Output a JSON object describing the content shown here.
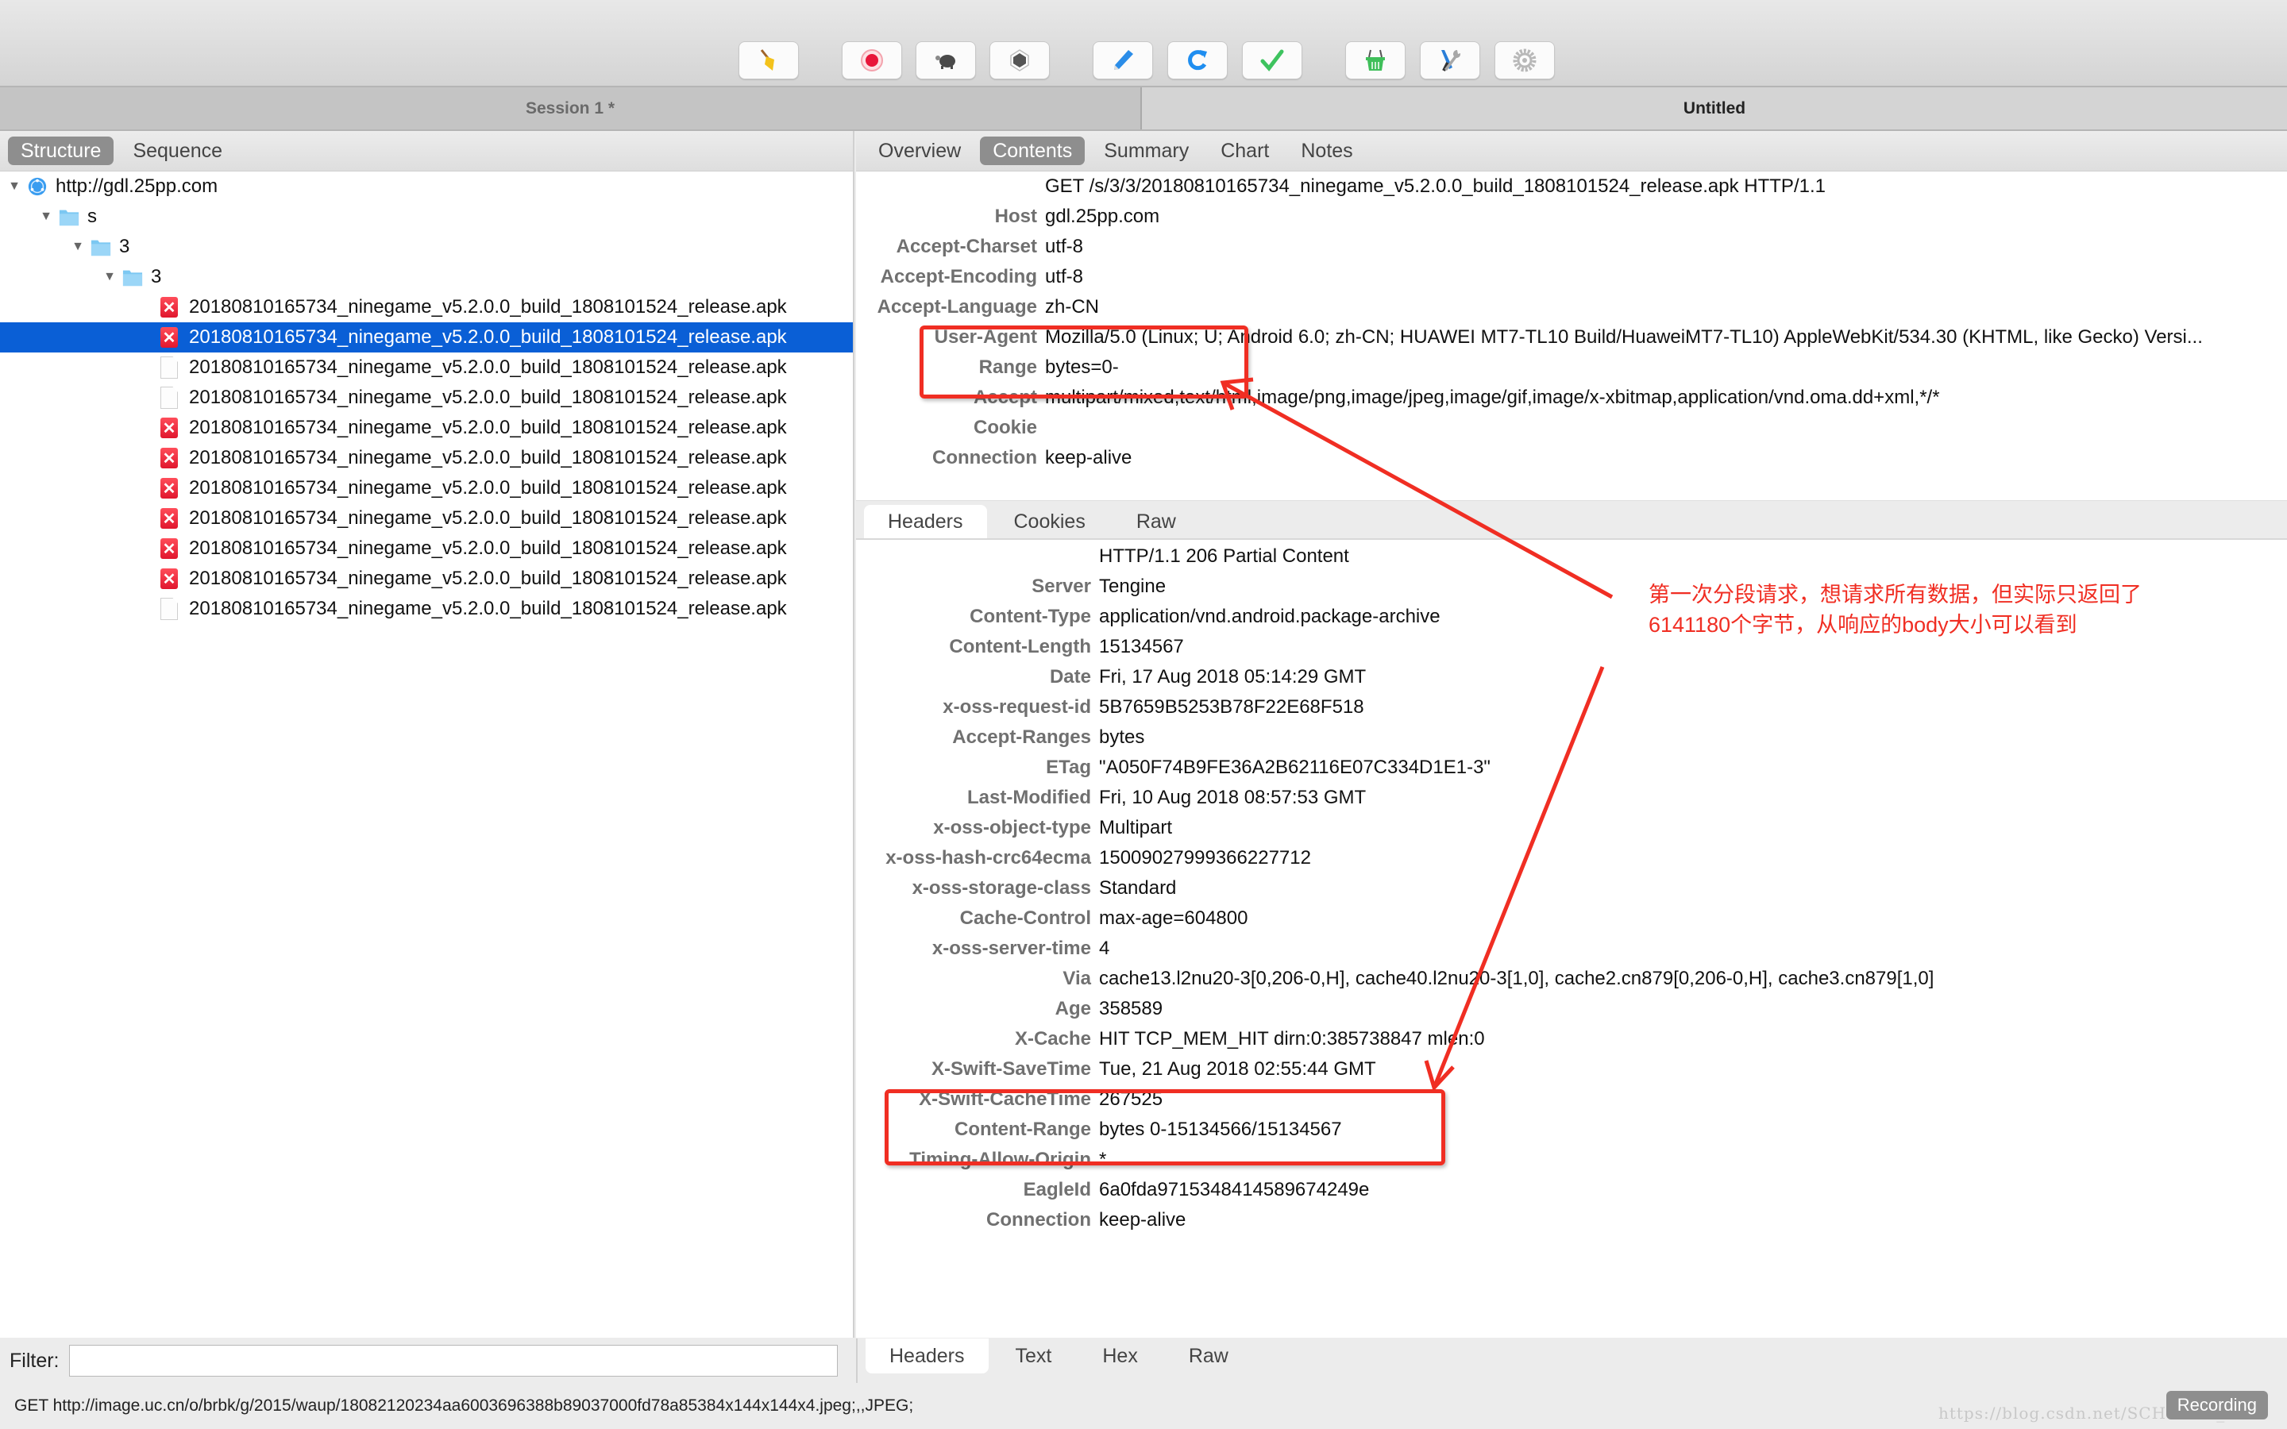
{
  "toolbar": {
    "buttons": [
      {
        "icon": "broom-icon",
        "label": "Clear"
      },
      {
        "icon": "record-icon",
        "label": "Record"
      },
      {
        "icon": "turtle-icon",
        "label": "Throttle"
      },
      {
        "icon": "stop-icon",
        "label": "Breakpoints"
      },
      {
        "icon": "pen-icon",
        "label": "Edit"
      },
      {
        "icon": "refresh-icon",
        "label": "Repeat"
      },
      {
        "icon": "check-icon",
        "label": "Validate"
      },
      {
        "icon": "basket-icon",
        "label": "Tools"
      },
      {
        "icon": "wrench-screwdriver-icon",
        "label": "Settings"
      },
      {
        "icon": "gear-icon",
        "label": "Preferences"
      }
    ]
  },
  "sessions": {
    "left": "Session 1 *",
    "right": "Untitled"
  },
  "left_tabs": [
    "Structure",
    "Sequence"
  ],
  "left_active_tab": "Structure",
  "tree": {
    "host": "http://gdl.25pp.com",
    "folders": [
      "s",
      "3",
      "3"
    ],
    "files": [
      {
        "name": "20180810165734_ninegame_v5.2.0.0_build_1808101524_release.apk",
        "status": "error",
        "selected": false
      },
      {
        "name": "20180810165734_ninegame_v5.2.0.0_build_1808101524_release.apk",
        "status": "error",
        "selected": true
      },
      {
        "name": "20180810165734_ninegame_v5.2.0.0_build_1808101524_release.apk",
        "status": "plain",
        "selected": false
      },
      {
        "name": "20180810165734_ninegame_v5.2.0.0_build_1808101524_release.apk",
        "status": "plain",
        "selected": false
      },
      {
        "name": "20180810165734_ninegame_v5.2.0.0_build_1808101524_release.apk",
        "status": "error",
        "selected": false
      },
      {
        "name": "20180810165734_ninegame_v5.2.0.0_build_1808101524_release.apk",
        "status": "error",
        "selected": false
      },
      {
        "name": "20180810165734_ninegame_v5.2.0.0_build_1808101524_release.apk",
        "status": "error",
        "selected": false
      },
      {
        "name": "20180810165734_ninegame_v5.2.0.0_build_1808101524_release.apk",
        "status": "error",
        "selected": false
      },
      {
        "name": "20180810165734_ninegame_v5.2.0.0_build_1808101524_release.apk",
        "status": "error",
        "selected": false
      },
      {
        "name": "20180810165734_ninegame_v5.2.0.0_build_1808101524_release.apk",
        "status": "error",
        "selected": false
      },
      {
        "name": "20180810165734_ninegame_v5.2.0.0_build_1808101524_release.apk",
        "status": "plain",
        "selected": false
      }
    ]
  },
  "right_tabs": [
    "Overview",
    "Contents",
    "Summary",
    "Chart",
    "Notes"
  ],
  "right_active_tab": "Contents",
  "request": {
    "request_line": "GET /s/3/3/20180810165734_ninegame_v5.2.0.0_build_1808101524_release.apk HTTP/1.1",
    "headers": [
      {
        "name": "Host",
        "value": "gdl.25pp.com"
      },
      {
        "name": "Accept-Charset",
        "value": "utf-8"
      },
      {
        "name": "Accept-Encoding",
        "value": "utf-8"
      },
      {
        "name": "Accept-Language",
        "value": "zh-CN"
      },
      {
        "name": "User-Agent",
        "value": "Mozilla/5.0 (Linux; U; Android 6.0; zh-CN; HUAWEI MT7-TL10 Build/HuaweiMT7-TL10) AppleWebKit/534.30 (KHTML, like Gecko) Versi..."
      },
      {
        "name": "Range",
        "value": "bytes=0-"
      },
      {
        "name": "Accept",
        "value": "multipart/mixed,text/html,image/png,image/jpeg,image/gif,image/x-xbitmap,application/vnd.oma.dd+xml,*/*"
      },
      {
        "name": "Cookie",
        "value": ""
      },
      {
        "name": "Connection",
        "value": "keep-alive"
      }
    ]
  },
  "request_subtabs": [
    "Headers",
    "Cookies",
    "Raw"
  ],
  "request_active_subtab": "Headers",
  "response": {
    "status_line": "HTTP/1.1 206 Partial Content",
    "headers": [
      {
        "name": "Server",
        "value": "Tengine"
      },
      {
        "name": "Content-Type",
        "value": "application/vnd.android.package-archive"
      },
      {
        "name": "Content-Length",
        "value": "15134567"
      },
      {
        "name": "Date",
        "value": "Fri, 17 Aug 2018 05:14:29 GMT"
      },
      {
        "name": "x-oss-request-id",
        "value": "5B7659B5253B78F22E68F518"
      },
      {
        "name": "Accept-Ranges",
        "value": "bytes"
      },
      {
        "name": "ETag",
        "value": "\"A050F74B9FE36A2B62116E07C334D1E1-3\""
      },
      {
        "name": "Last-Modified",
        "value": "Fri, 10 Aug 2018 08:57:53 GMT"
      },
      {
        "name": "x-oss-object-type",
        "value": "Multipart"
      },
      {
        "name": "x-oss-hash-crc64ecma",
        "value": "15009027999366227712"
      },
      {
        "name": "x-oss-storage-class",
        "value": "Standard"
      },
      {
        "name": "Cache-Control",
        "value": "max-age=604800"
      },
      {
        "name": "x-oss-server-time",
        "value": "4"
      },
      {
        "name": "Via",
        "value": "cache13.l2nu20-3[0,206-0,H], cache40.l2nu20-3[1,0], cache2.cn879[0,206-0,H], cache3.cn879[1,0]"
      },
      {
        "name": "Age",
        "value": "358589"
      },
      {
        "name": "X-Cache",
        "value": "HIT TCP_MEM_HIT dirn:0:385738847 mlen:0"
      },
      {
        "name": "X-Swift-SaveTime",
        "value": "Tue, 21 Aug 2018 02:55:44 GMT"
      },
      {
        "name": "X-Swift-CacheTime",
        "value": "267525"
      },
      {
        "name": "Content-Range",
        "value": "bytes 0-15134566/15134567"
      },
      {
        "name": "Timing-Allow-Origin",
        "value": "*"
      },
      {
        "name": "EagleId",
        "value": "6a0fda9715348414589674249e"
      },
      {
        "name": "Connection",
        "value": "keep-alive"
      }
    ]
  },
  "response_subtabs": [
    "Headers",
    "Text",
    "Hex",
    "Raw"
  ],
  "response_active_subtab": "Headers",
  "filter": {
    "label": "Filter:",
    "value": "",
    "placeholder": ""
  },
  "status": {
    "text": "GET http://image.uc.cn/o/brbk/g/2015/waup/18082120234aa6003696388b89037000fd78a85384x144x144x4.jpeg;,,JPEG;",
    "recording_label": "Recording",
    "watermark": "https://blog.csdn.net/SCHOLAR_II"
  },
  "annotation": {
    "lines": [
      "第一次分段请求，想请求所有数据，但实际只返回了",
      "6141180个字节，从响应的body大小可以看到"
    ],
    "color": "#f02e23"
  },
  "colors": {
    "selection": "#0a5fd6",
    "active_tab": "#8e8e8e",
    "error_icon": "#e0172e"
  }
}
